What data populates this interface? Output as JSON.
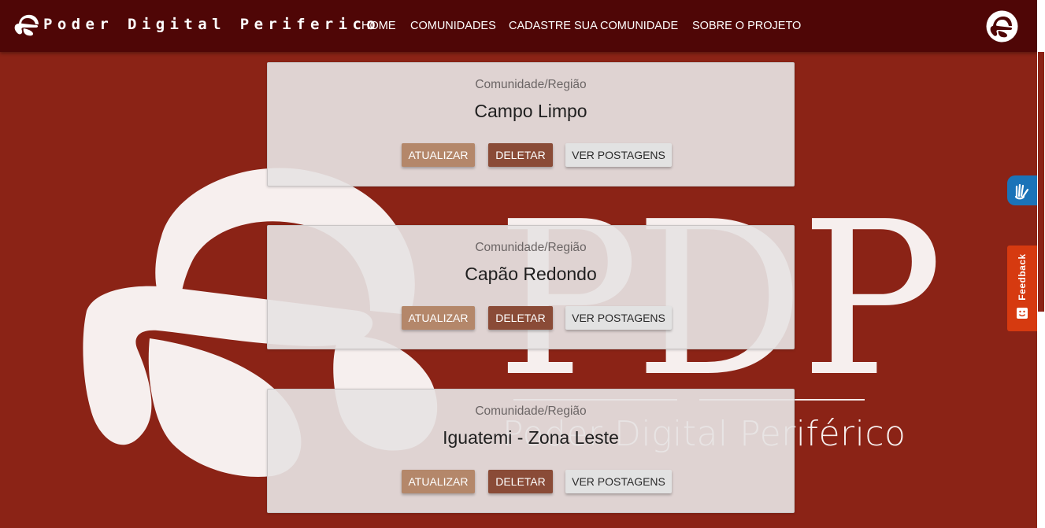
{
  "navbar": {
    "brand": "Poder Digital Periferico",
    "links": [
      "HOME",
      "COMUNIDADES",
      "CADASTRE SUA COMUNIDADE",
      "SOBRE O PROJETO"
    ]
  },
  "watermark": {
    "letters": "PDP",
    "subtitle": "Poder Digital Periférico"
  },
  "cards": [
    {
      "caption": "Comunidade/Região",
      "title": "Campo Limpo",
      "update_label": "ATUALIZAR",
      "delete_label": "DELETAR",
      "posts_label": "VER POSTAGENS"
    },
    {
      "caption": "Comunidade/Região",
      "title": "Capão Redondo",
      "update_label": "ATUALIZAR",
      "delete_label": "DELETAR",
      "posts_label": "VER POSTAGENS"
    },
    {
      "caption": "Comunidade/Região",
      "title": "Iguatemi - Zona Leste",
      "update_label": "ATUALIZAR",
      "delete_label": "DELETAR",
      "posts_label": "VER POSTAGENS"
    }
  ],
  "widgets": {
    "feedback_label": "Feedback",
    "accessibility_icon": "sign-language-icon",
    "feedback_icon": "smile-icon"
  },
  "colors": {
    "navbar": "#4f0606",
    "background": "#8b2316",
    "update_button": "#b4876a",
    "delete_button": "#8a4b37",
    "posts_button": "#e2e2e2",
    "feedback_tab": "#d63a10",
    "accessibility_button": "#1b73b8"
  }
}
